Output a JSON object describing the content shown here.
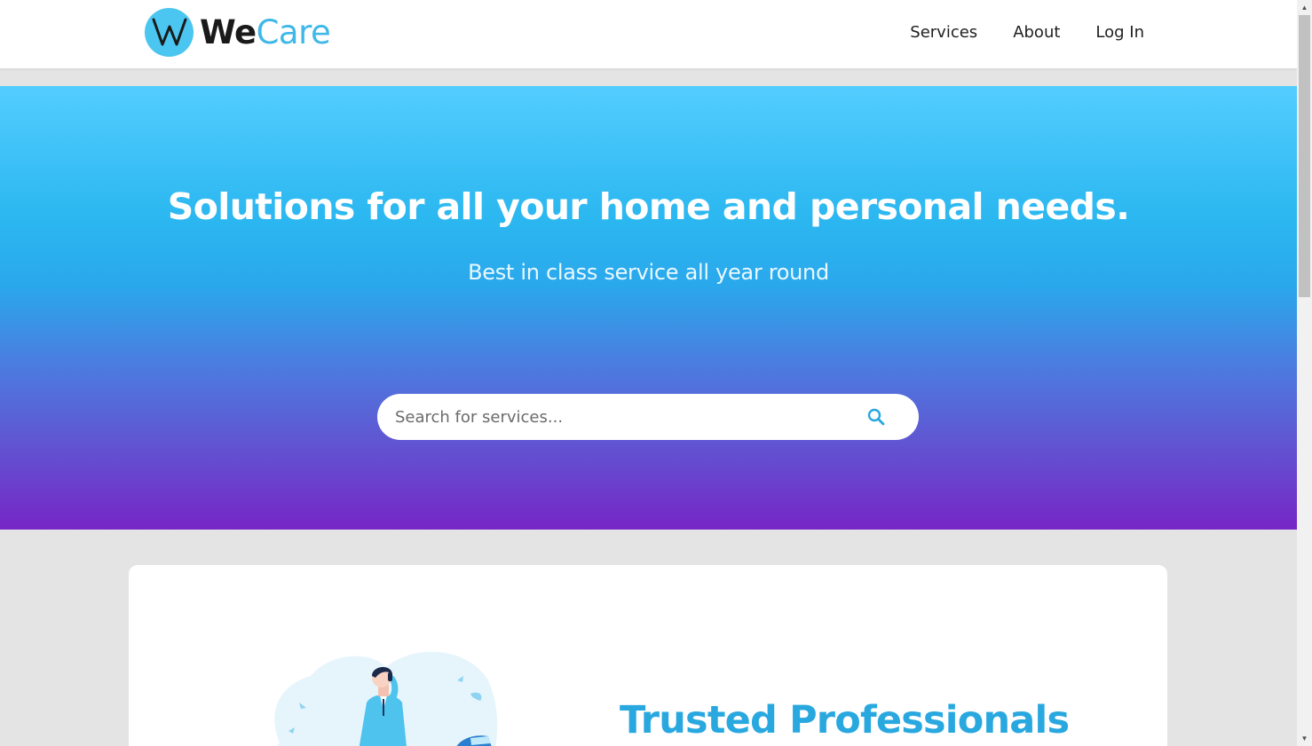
{
  "header": {
    "logo_we": "We",
    "logo_care": "Care",
    "nav": [
      "Services",
      "About",
      "Log In"
    ]
  },
  "hero": {
    "title": "Solutions for all your home and personal needs.",
    "subtitle": "Best in class service all year round",
    "search_placeholder": "Search for services..."
  },
  "card": {
    "title": "Trusted Professionals"
  },
  "colors": {
    "brand_blue": "#4ac6f0",
    "gradient_top": "#53cdfe",
    "gradient_bottom": "#7626c6",
    "title_blue": "#29a8e0"
  },
  "icons": [
    "w-logo-icon",
    "search-icon",
    "person-phone-illustration",
    "scroll-up-icon",
    "scroll-down-icon"
  ]
}
